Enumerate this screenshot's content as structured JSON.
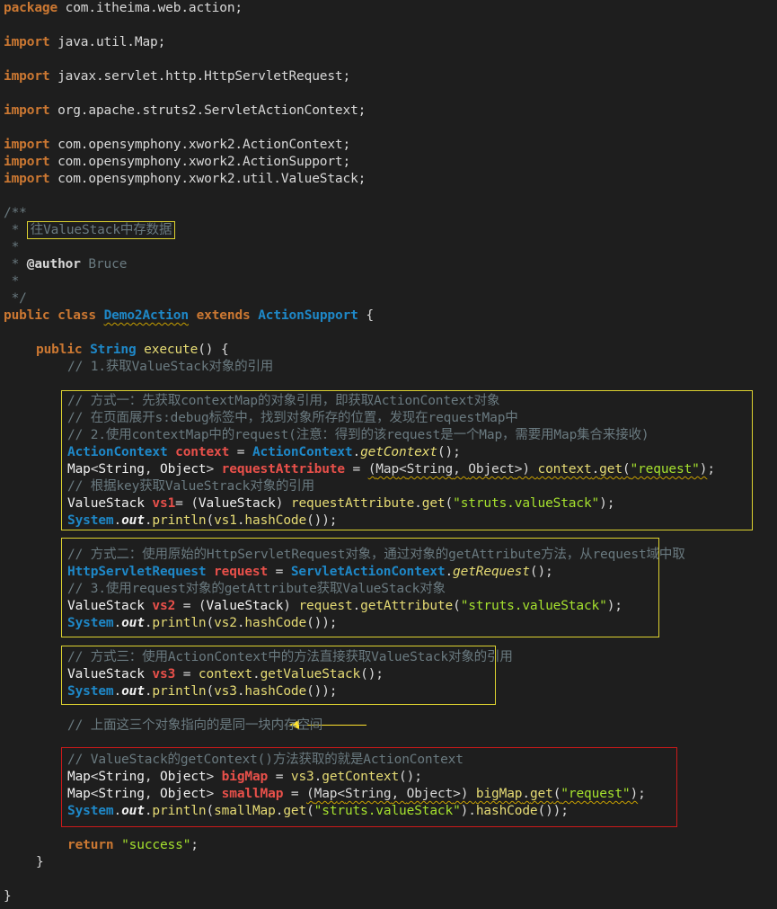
{
  "editor": {
    "lines": {
      "pkg_kw": "package",
      "pkg_name": " com.itheima.web.action;",
      "import_kw": "import",
      "imp1": " java.util.Map;",
      "imp2": " javax.servlet.http.HttpServletRequest;",
      "imp3": " org.apache.struts2.ServletActionContext;",
      "imp4": " com.opensymphony.xwork2.ActionContext;",
      "imp5": " com.opensymphony.xwork2.ActionSupport;",
      "imp6": " com.opensymphony.xwork2.util.ValueStack;",
      "doc_open": "/**",
      "doc_star": " * ",
      "doc_summary": "往ValueStack中存数据",
      "doc_blank": " *",
      "doc_author_tag": "@author",
      "doc_author_name": " Bruce",
      "doc_close": " */",
      "public_kw": "public",
      "class_kw": "class",
      "class_name": "Demo2Action",
      "extends_kw": "extends",
      "super_name": "ActionSupport",
      "brace_open": " {",
      "string_type": "String",
      "method_name": "execute",
      "method_tail": "() {",
      "c1": "// 1.获取ValueStack对象的引用",
      "b1_c1": "// 方式一：先获取contextMap的对象引用，即获取ActionContext对象",
      "b1_c2": "// 在页面展开s:debug标签中，找到对象所存的位置，发现在requestMap中",
      "b1_c3": "// 2.使用contextMap中的request(注意：得到的该request是一个Map，需要用Map集合来接收)",
      "b1_c4": "// 根据key获取ValueStrack对象的引用",
      "b2_c1": "// 方式二：使用原始的HttpServletRequest对象，通过对象的getAttribute方法，从request域中取",
      "b2_c2": "// 3.使用request对象的getAttribute获取ValueStack对象",
      "b3_c1": "// 方式三：使用ActionContext中的方法直接获取ValueStack对象的引用",
      "note": "// 上面这三个对象指向的是同一块内存空间",
      "b4_c1": "// ValueStack的getContext()方法获取的就是ActionContext",
      "return_kw": "return",
      "return_val": "\"success\"",
      "semi": ";",
      "close_method": "}",
      "close_class": "}"
    },
    "tokens": {
      "ActionContext": "ActionContext",
      "context": "context",
      "getContext": "getContext",
      "Map": "Map",
      "String": "String",
      "Object": "Object",
      "requestAttribute": "requestAttribute",
      "request_str": "\"request\"",
      "get": "get",
      "ValueStack": "ValueStack",
      "vs1": "vs1",
      "vs2": "vs2",
      "vs3": "vs3",
      "sv_str": "\"struts.valueStack\"",
      "System": "System",
      "out": "out",
      "println": "println",
      "hashCode": "hashCode",
      "HttpServletRequest": "HttpServletRequest",
      "request": "request",
      "ServletActionContext": "ServletActionContext",
      "getRequest": "getRequest",
      "getAttribute": "getAttribute",
      "getValueStack": "getValueStack",
      "bigMap": "bigMap",
      "smallMap": "smallMap"
    }
  },
  "colors": {
    "background": "#1e1e1e",
    "keyword": "#cc7832",
    "type": "#1e88c8",
    "method": "#e6db74",
    "comment": "#6a7a80",
    "string": "#a6e22e",
    "local_var": "#e8504a",
    "yellow_box": "#ddd230",
    "red_box": "#cc1a1a",
    "arrow": "#ffe22e"
  }
}
